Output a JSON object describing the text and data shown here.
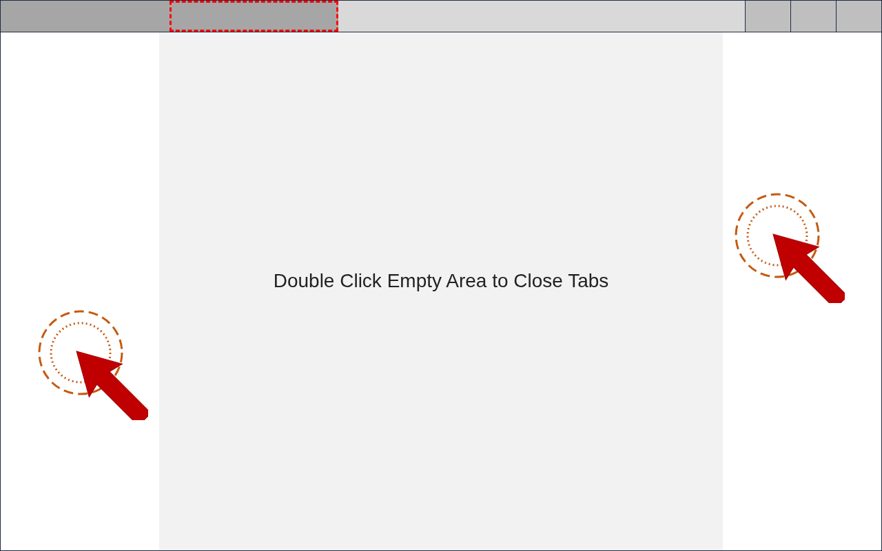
{
  "tabs": [
    {
      "highlighted": false
    },
    {
      "highlighted": true
    }
  ],
  "content": {
    "message": "Double Click Empty Area to Close Tabs"
  }
}
